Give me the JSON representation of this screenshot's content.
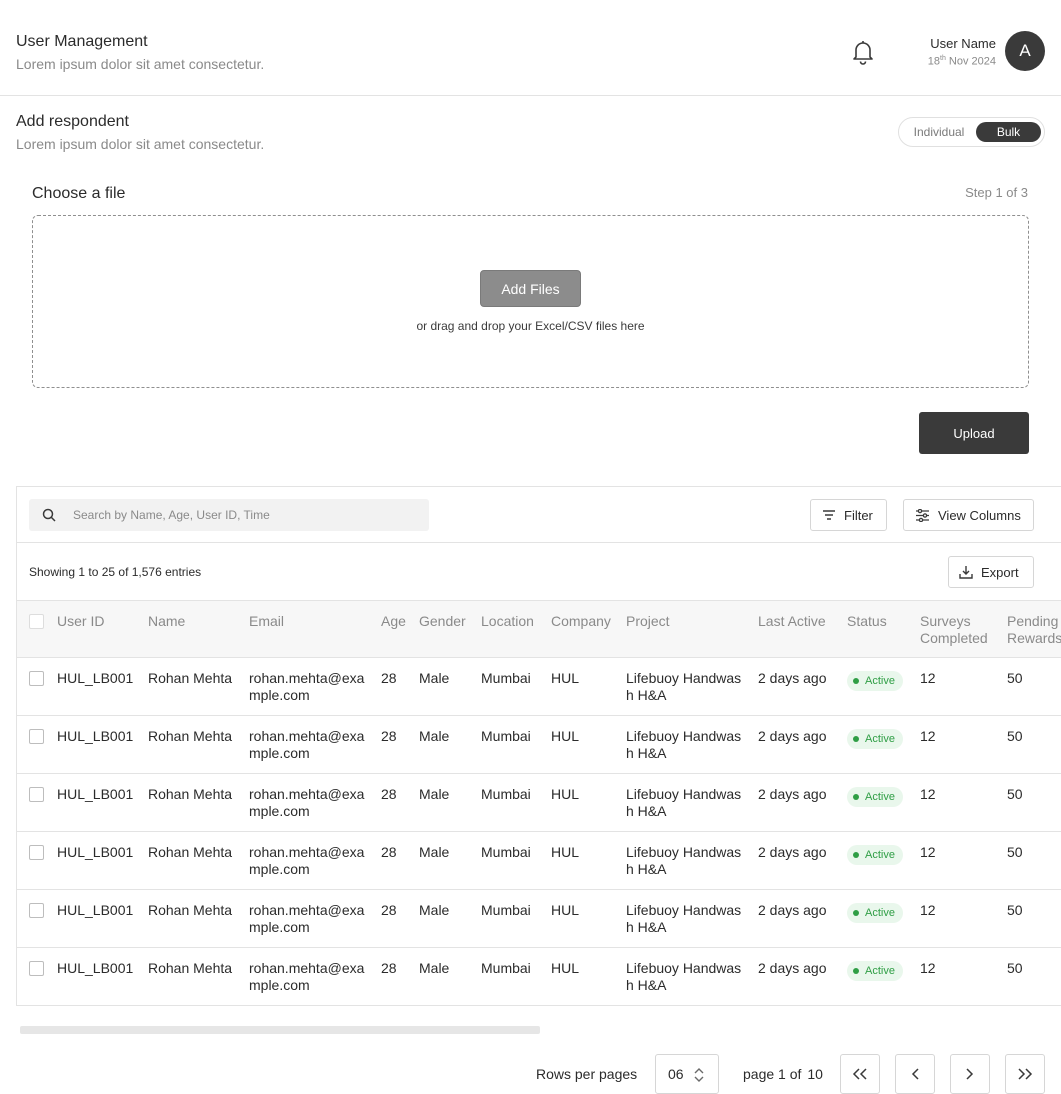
{
  "header": {
    "title": "User Management",
    "subtitle": "Lorem ipsum dolor sit amet consectetur.",
    "user_name": "User Name",
    "date_day": "18",
    "date_suffix": "th",
    "date_rest": " Nov 2024",
    "avatar_initial": "A",
    "bell_icon": "bell-icon"
  },
  "section": {
    "title": "Add respondent",
    "subtitle": "Lorem ipsum dolor sit amet consectetur.",
    "toggle_individual": "Individual",
    "toggle_bulk": "Bulk",
    "toggle_selected": "Bulk"
  },
  "upload": {
    "choose_label": "Choose a file",
    "step_text": "Step 1 of 3",
    "add_files_label": "Add Files",
    "drag_text": "or drag and drop your Excel/CSV files here",
    "upload_label": "Upload"
  },
  "toolbar": {
    "search_placeholder": "Search by Name, Age, User ID, Time",
    "filter_label": "Filter",
    "view_columns_label": "View Columns",
    "export_label": "Export",
    "showing_text": "Showing 1 to 25 of 1,576 entries"
  },
  "table": {
    "columns": [
      "User ID",
      "Name",
      "Email",
      "Age",
      "Gender",
      "Location",
      "Company",
      "Project",
      "Last Active",
      "Status",
      "Surveys Completed",
      "Pending Rewards"
    ],
    "rows": [
      {
        "user_id": "HUL_LB001",
        "name": "Rohan Mehta",
        "email": "rohan.mehta@example.com",
        "age": "28",
        "gender": "Male",
        "location": "Mumbai",
        "company": "HUL",
        "project": "Lifebuoy Handwash H&A",
        "last_active": "2 days ago",
        "status": "Active",
        "surveys": "12",
        "pending": "50"
      },
      {
        "user_id": "HUL_LB001",
        "name": "Rohan Mehta",
        "email": "rohan.mehta@example.com",
        "age": "28",
        "gender": "Male",
        "location": "Mumbai",
        "company": "HUL",
        "project": "Lifebuoy Handwash H&A",
        "last_active": "2 days ago",
        "status": "Active",
        "surveys": "12",
        "pending": "50"
      },
      {
        "user_id": "HUL_LB001",
        "name": "Rohan Mehta",
        "email": "rohan.mehta@example.com",
        "age": "28",
        "gender": "Male",
        "location": "Mumbai",
        "company": "HUL",
        "project": "Lifebuoy Handwash H&A",
        "last_active": "2 days ago",
        "status": "Active",
        "surveys": "12",
        "pending": "50"
      },
      {
        "user_id": "HUL_LB001",
        "name": "Rohan Mehta",
        "email": "rohan.mehta@example.com",
        "age": "28",
        "gender": "Male",
        "location": "Mumbai",
        "company": "HUL",
        "project": "Lifebuoy Handwash H&A",
        "last_active": "2 days ago",
        "status": "Active",
        "surveys": "12",
        "pending": "50"
      },
      {
        "user_id": "HUL_LB001",
        "name": "Rohan Mehta",
        "email": "rohan.mehta@example.com",
        "age": "28",
        "gender": "Male",
        "location": "Mumbai",
        "company": "HUL",
        "project": "Lifebuoy Handwash H&A",
        "last_active": "2 days ago",
        "status": "Active",
        "surveys": "12",
        "pending": "50"
      },
      {
        "user_id": "HUL_LB001",
        "name": "Rohan Mehta",
        "email": "rohan.mehta@example.com",
        "age": "28",
        "gender": "Male",
        "location": "Mumbai",
        "company": "HUL",
        "project": "Lifebuoy Handwash H&A",
        "last_active": "2 days ago",
        "status": "Active",
        "surveys": "12",
        "pending": "50"
      }
    ]
  },
  "pagination": {
    "rows_per_page_label": "Rows per pages",
    "rows_per_page_value": "06",
    "page_text": "page 1 of",
    "total_pages": "10"
  },
  "colors": {
    "primary_dark": "#3a3a3a",
    "active_green": "#2f9e45",
    "active_bg": "#e9f7ec"
  }
}
